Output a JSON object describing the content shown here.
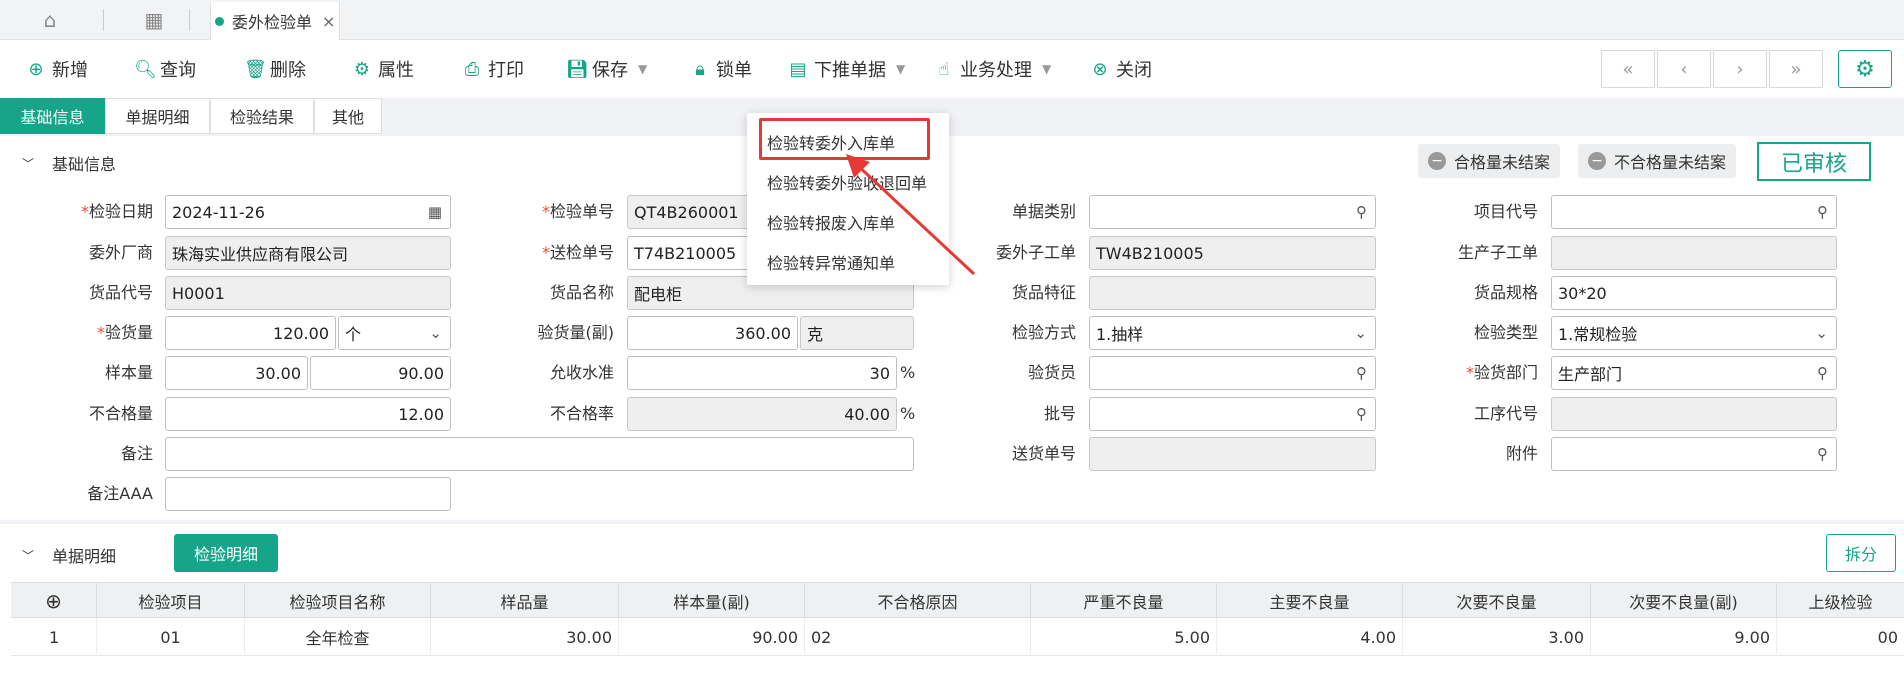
{
  "tabbar": {
    "home_icon": "home-icon",
    "apps_icon": "apps-icon",
    "active_tab": "委外检验单",
    "close": "×"
  },
  "toolbar": {
    "add": "新增",
    "query": "查询",
    "delete": "删除",
    "props": "属性",
    "print": "打印",
    "save": "保存",
    "lock": "锁单",
    "push": "下推单据",
    "business": "业务处理",
    "close": "关闭",
    "nav": [
      "«",
      "‹",
      "›",
      "»"
    ],
    "gear": "⚙"
  },
  "subtabs": [
    "基础信息",
    "单据明细",
    "检验结果",
    "其他"
  ],
  "dropdown": {
    "items": [
      "检验转委外入库单",
      "检验转委外验收退回单",
      "检验转报废入库单",
      "检验转异常通知单"
    ]
  },
  "section1": {
    "title": "基础信息",
    "badge_pass": "合格量未结案",
    "badge_fail": "不合格量未结案",
    "approved": "已审核"
  },
  "form": {
    "inspect_date": {
      "label": "检验日期",
      "value": "2024-11-26"
    },
    "vendor": {
      "label": "委外厂商",
      "value": "珠海实业供应商有限公司"
    },
    "item_code": {
      "label": "货品代号",
      "value": "H0001"
    },
    "inspect_qty": {
      "label": "验货量",
      "value": "120.00",
      "unit": "个"
    },
    "sample_qty": {
      "label": "样本量",
      "value": "30.00",
      "value2": "90.00"
    },
    "defect_qty": {
      "label": "不合格量",
      "value": "12.00"
    },
    "remark": {
      "label": "备注",
      "value": ""
    },
    "remark_aaa": {
      "label": "备注AAA",
      "value": ""
    },
    "inspect_no": {
      "label": "检验单号",
      "value": "QT4B260001"
    },
    "send_no": {
      "label": "送检单号",
      "value": "T74B210005"
    },
    "item_name": {
      "label": "货品名称",
      "value": "配电柜"
    },
    "inspect_qty2": {
      "label": "验货量(副)",
      "value": "360.00",
      "unit": "克"
    },
    "accept_level": {
      "label": "允收水准",
      "value": "30",
      "pct": "%"
    },
    "defect_rate": {
      "label": "不合格率",
      "value": "40.00",
      "pct": "%"
    },
    "doc_type": {
      "label": "单据类别",
      "value": ""
    },
    "sub_order": {
      "label": "委外子工单",
      "value": "TW4B210005"
    },
    "item_feature": {
      "label": "货品特征",
      "value": ""
    },
    "inspect_method": {
      "label": "检验方式",
      "value": "1.抽样"
    },
    "inspector": {
      "label": "验货员",
      "value": ""
    },
    "batch": {
      "label": "批号",
      "value": ""
    },
    "delivery_no": {
      "label": "送货单号",
      "value": ""
    },
    "project_code": {
      "label": "项目代号",
      "value": ""
    },
    "prod_sub_order": {
      "label": "生产子工单",
      "value": ""
    },
    "item_spec": {
      "label": "货品规格",
      "value": "30*20"
    },
    "inspect_type": {
      "label": "检验类型",
      "value": "1.常规检验"
    },
    "inspect_dept": {
      "label": "验货部门",
      "value": "生产部门"
    },
    "process_code": {
      "label": "工序代号",
      "value": ""
    },
    "attachment": {
      "label": "附件",
      "value": ""
    }
  },
  "section2": {
    "title": "单据明细",
    "detail_btn": "检验明细",
    "split_btn": "拆分"
  },
  "table": {
    "headers": [
      "⊕",
      "检验项目",
      "检验项目名称",
      "样品量",
      "样本量(副)",
      "不合格原因",
      "严重不良量",
      "主要不良量",
      "次要不良量",
      "次要不良量(副)",
      "上级检验"
    ],
    "row": [
      "1",
      "01",
      "全年检查",
      "30.00",
      "90.00",
      "02",
      "5.00",
      "4.00",
      "3.00",
      "9.00",
      "00"
    ]
  }
}
